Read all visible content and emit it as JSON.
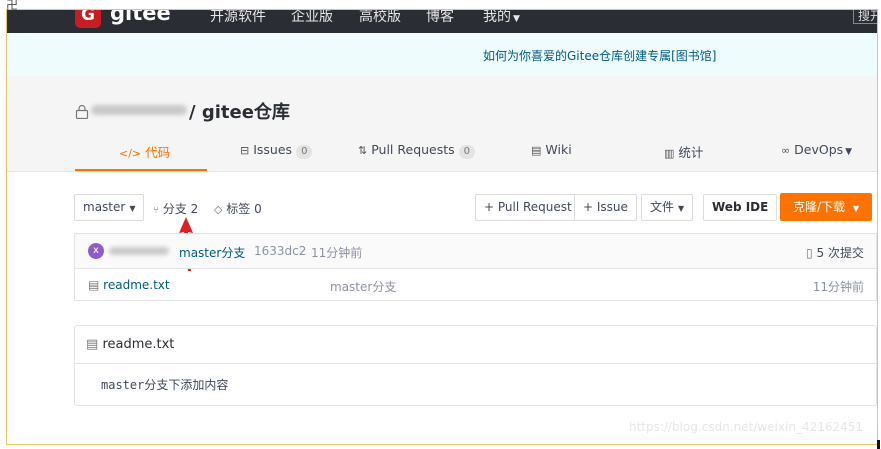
{
  "topnav": {
    "logo_letter": "G",
    "logo_text": "gitee",
    "items": [
      "开源软件",
      "企业版",
      "高校版",
      "博客",
      "我的"
    ],
    "search_label": "搜开"
  },
  "announcement": {
    "text": "如何为你喜爱的Gitee仓库创建专属[图书馆]"
  },
  "repo": {
    "name": "/ gitee仓库"
  },
  "tabs": [
    {
      "label": "代码",
      "icon": "code-icon"
    },
    {
      "label": "Issues",
      "count": "0",
      "icon": "issues-icon"
    },
    {
      "label": "Pull Requests",
      "count": "0",
      "icon": "pull-request-icon"
    },
    {
      "label": "Wiki",
      "icon": "wiki-icon"
    },
    {
      "label": "统计",
      "icon": "stats-icon"
    },
    {
      "label": "DevOps",
      "icon": "devops-icon"
    }
  ],
  "toolbar": {
    "branch": "master",
    "branches_label": "分支 2",
    "tags_label": "标签 0",
    "pull_request_btn": "+ Pull Request",
    "issue_btn": "+ Issue",
    "file_btn": "文件",
    "web_ide_btn": "Web IDE",
    "clone_btn": "克隆/下载"
  },
  "commit": {
    "avatar_letter": "x",
    "message": "master分支",
    "hash": "1633dc2",
    "time": "11分钟前",
    "count_label": "5 次提交"
  },
  "files": [
    {
      "name": "readme.txt",
      "commit": "master分支",
      "time": "11分钟前"
    }
  ],
  "readme": {
    "title": "readme.txt",
    "content": "master分支下添加内容"
  },
  "watermark": "https://blog.csdn.net/weixin_42162451",
  "colors": {
    "accent": "#fe7300",
    "nav_bg": "#2a2d33",
    "link": "#005980"
  }
}
